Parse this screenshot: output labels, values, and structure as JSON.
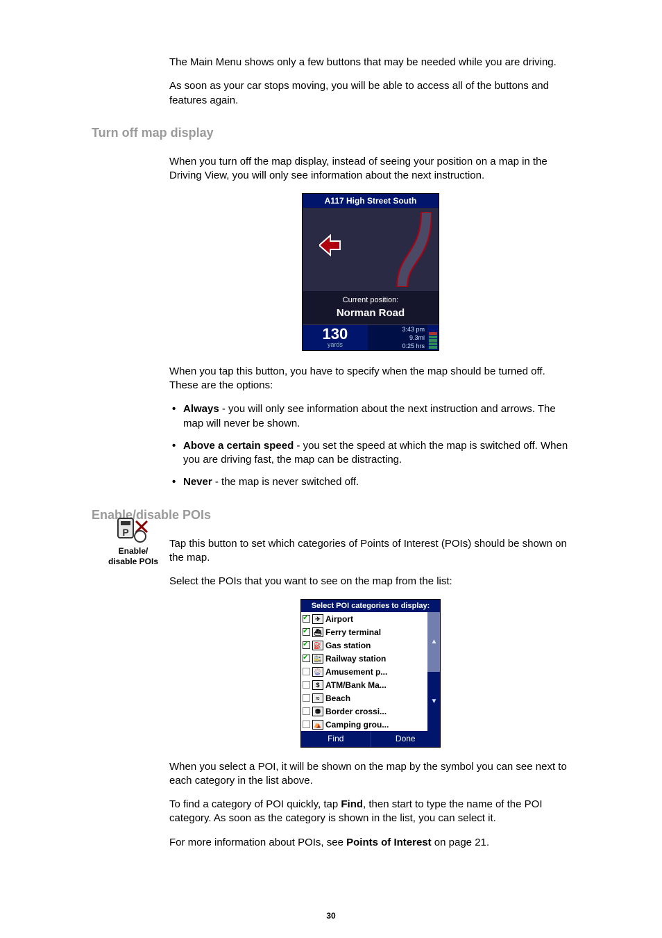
{
  "intro": {
    "p1": "The Main Menu shows only a few buttons that may be needed while you are driving.",
    "p2": "As soon as your car stops moving, you will be able to access all of the buttons and features again."
  },
  "section_turn_off": {
    "heading": "Turn off map display",
    "p1": "When you turn off the map display, instead of seeing your position on a map in the Driving View, you will only see information about the next instruction.",
    "p2": "When you tap this button, you have to specify when the map should be turned off. These are the options:",
    "bullets": [
      {
        "label": "Always",
        "rest": " - you will only see information about the next instruction and arrows. The map will never be shown."
      },
      {
        "label": "Above a certain speed",
        "rest": " - you set the speed at which the map is switched off. When you are driving fast, the map can be distracting."
      },
      {
        "label": "Never",
        "rest": " - the map is never switched off."
      }
    ]
  },
  "driveview": {
    "street_top": "A117 High Street South",
    "current_position_label": "Current position:",
    "road": "Norman Road",
    "distance_value": "130",
    "distance_unit": "yards",
    "time": "3:43 pm",
    "remaining_dist": "9.3mi",
    "remaining_time": "0:25 hrs"
  },
  "section_pois": {
    "heading": "Enable/disable POIs",
    "icon_caption": "Enable/\ndisable POIs",
    "p1": "Tap this button to set which categories of Points of Interest (POIs) should be shown on the map.",
    "p2": "Select the POIs that you want to see on the map from the list:",
    "p3": "When you select a POI, it will be shown on the map by the symbol you can see next to each category in the list above.",
    "p4a": "To find a category of POI quickly, tap ",
    "p4b": "Find",
    "p4c": ", then start to type the name of the POI category. As soon as the category is shown in the list, you can select it.",
    "p5a": "For more information about POIs, see ",
    "p5b": "Points of Interest",
    "p5c": " on page 21."
  },
  "poilist": {
    "title": "Select POI categories to display:",
    "items": [
      {
        "checked": true,
        "glyph": "✈",
        "label": "Airport"
      },
      {
        "checked": true,
        "glyph": "⛴",
        "label": "Ferry terminal"
      },
      {
        "checked": true,
        "glyph": "⛽",
        "label": "Gas station"
      },
      {
        "checked": true,
        "glyph": "🚉",
        "label": "Railway station"
      },
      {
        "checked": false,
        "glyph": "🎡",
        "label": "Amusement p..."
      },
      {
        "checked": false,
        "glyph": "$",
        "label": "ATM/Bank Ma..."
      },
      {
        "checked": false,
        "glyph": "≈",
        "label": "Beach"
      },
      {
        "checked": false,
        "glyph": "⛃",
        "label": "Border crossi..."
      },
      {
        "checked": false,
        "glyph": "⛺",
        "label": "Camping grou..."
      }
    ],
    "find": "Find",
    "done": "Done"
  },
  "page_number": "30"
}
